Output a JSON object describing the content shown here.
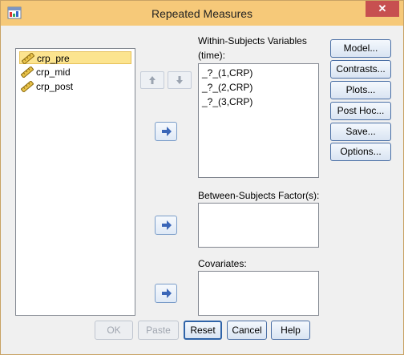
{
  "window": {
    "title": "Repeated Measures",
    "close_glyph": "✕"
  },
  "source_variables": {
    "items": [
      {
        "label": "crp_pre",
        "icon": "ruler-icon",
        "selected": true
      },
      {
        "label": "crp_mid",
        "icon": "ruler-icon",
        "selected": false
      },
      {
        "label": "crp_post",
        "icon": "ruler-icon",
        "selected": false
      }
    ]
  },
  "within_subjects": {
    "label_line1": "Within-Subjects Variables",
    "label_line2": "(time):",
    "items": [
      "_?_(1,CRP)",
      "_?_(2,CRP)",
      "_?_(3,CRP)"
    ]
  },
  "between_subjects": {
    "label": "Between-Subjects Factor(s):"
  },
  "covariates": {
    "label": "Covariates:"
  },
  "side_buttons": {
    "model": "Model...",
    "contrasts": "Contrasts...",
    "plots": "Plots...",
    "post_hoc": "Post Hoc...",
    "save": "Save...",
    "options": "Options..."
  },
  "bottom_buttons": {
    "ok": "OK",
    "paste": "Paste",
    "reset": "Reset",
    "cancel": "Cancel",
    "help": "Help"
  },
  "colors": {
    "titlebar": "#f6c979",
    "close": "#c75050",
    "selection": "#fce48f",
    "arrow_icon": "#3a66b8"
  }
}
